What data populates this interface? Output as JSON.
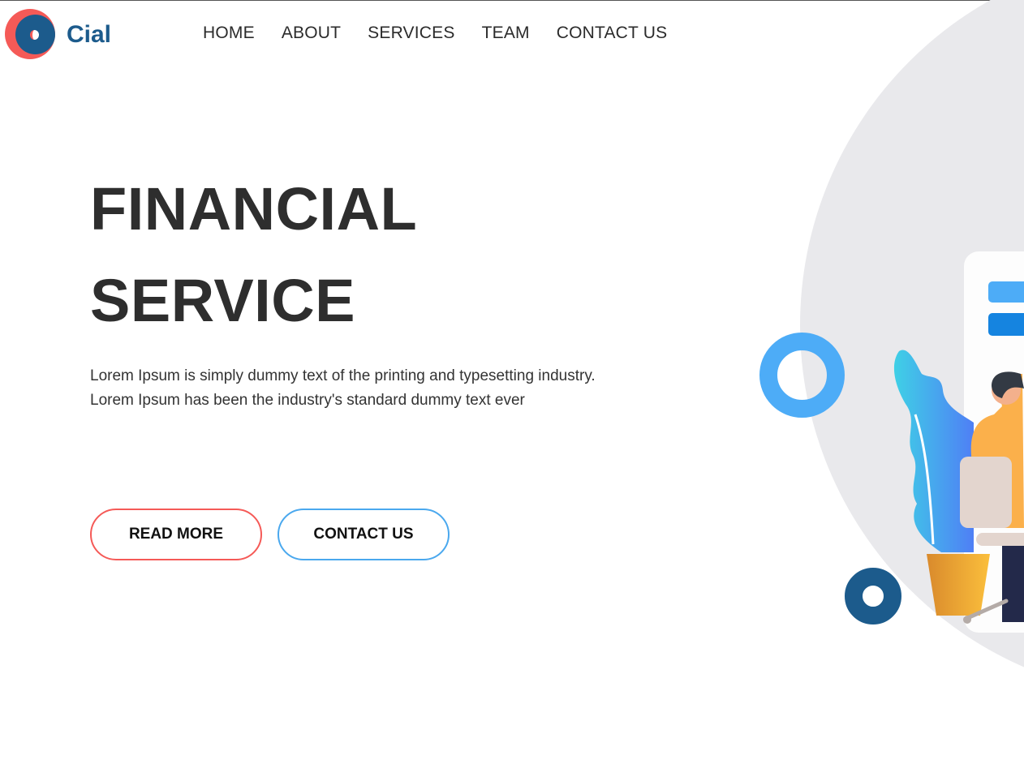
{
  "brand": {
    "name": "Cial",
    "colors": {
      "primary": "#1c5b8c",
      "accent_red": "#f55a57",
      "accent_blue": "#4dacf7"
    }
  },
  "nav": {
    "items": [
      {
        "label": "HOME"
      },
      {
        "label": "ABOUT"
      },
      {
        "label": "SERVICES"
      },
      {
        "label": "TEAM"
      },
      {
        "label": "CONTACT US"
      }
    ]
  },
  "hero": {
    "title_line1": "FINANCIAL",
    "title_line2": "SERVICE",
    "description_line1": "Lorem Ipsum is simply dummy text of the printing and typesetting industry.",
    "description_line2": "Lorem Ipsum has been the industry's standard dummy text ever",
    "buttons": {
      "read_more": "READ MORE",
      "contact_us": "CONTACT US"
    },
    "illustration": "person-at-desk-with-plant-illustration"
  }
}
